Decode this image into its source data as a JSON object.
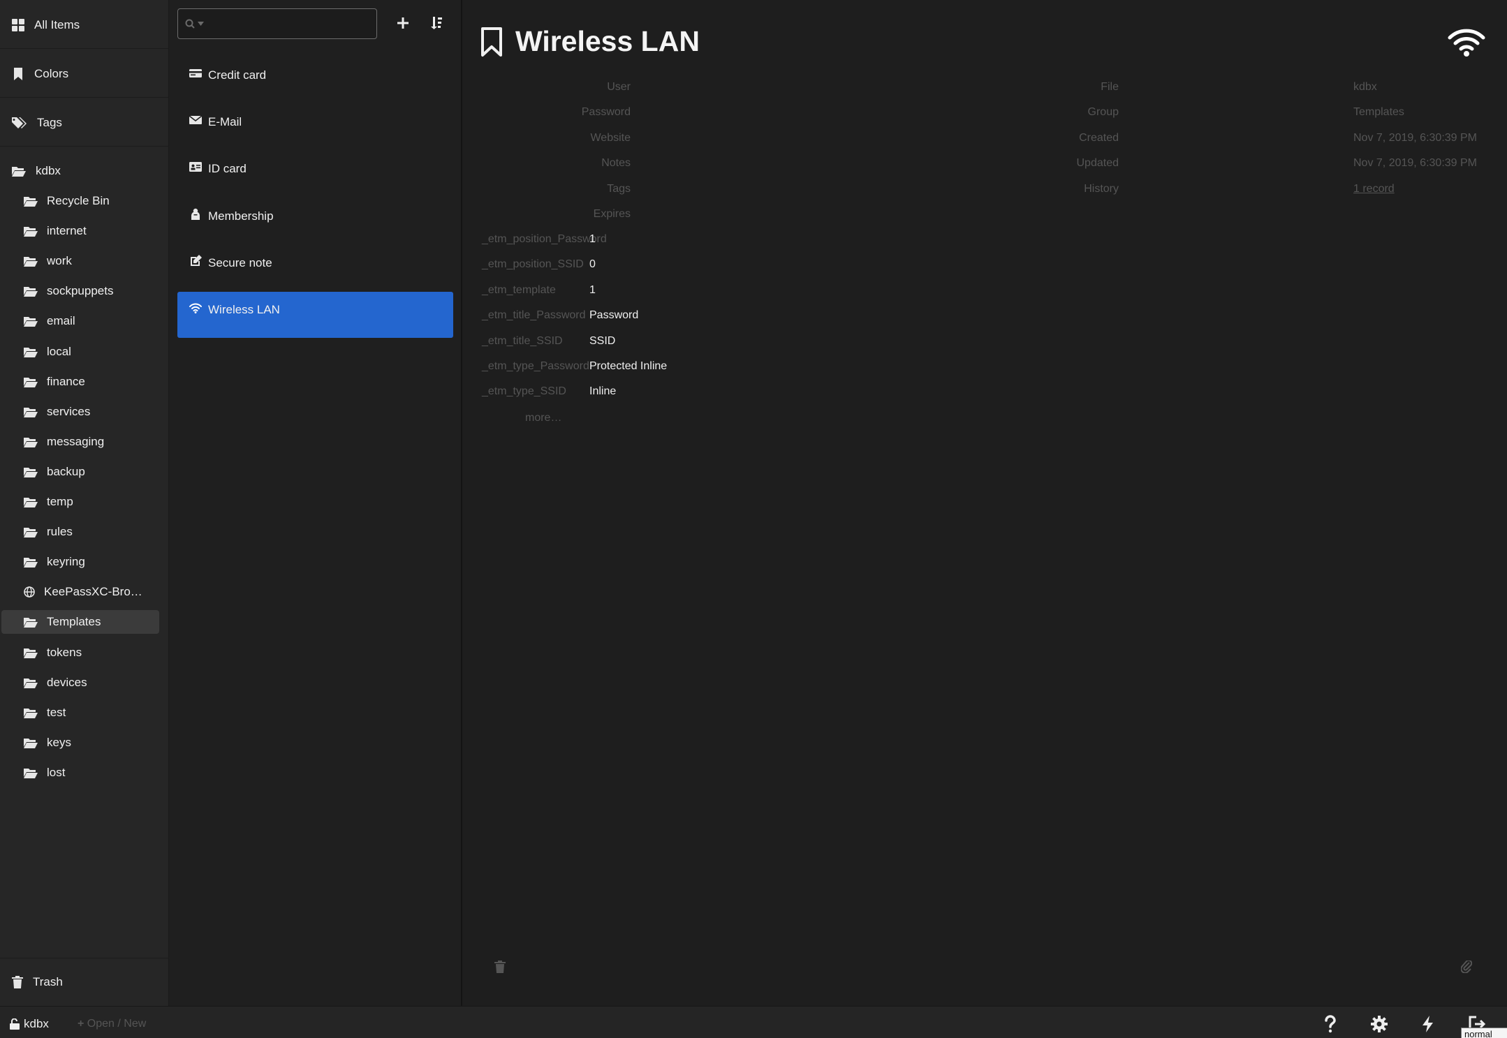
{
  "sidebar": {
    "all_items": "All Items",
    "colors": "Colors",
    "tags": "Tags",
    "db_name": "kdbx",
    "folders": [
      {
        "label": "Recycle Bin",
        "icon": "folder-open-icon"
      },
      {
        "label": "internet",
        "icon": "folder-open-icon"
      },
      {
        "label": "work",
        "icon": "folder-open-icon"
      },
      {
        "label": "sockpuppets",
        "icon": "folder-open-icon"
      },
      {
        "label": "email",
        "icon": "folder-open-icon"
      },
      {
        "label": "local",
        "icon": "folder-open-icon"
      },
      {
        "label": "finance",
        "icon": "folder-open-icon"
      },
      {
        "label": "services",
        "icon": "folder-open-icon"
      },
      {
        "label": "messaging",
        "icon": "folder-open-icon"
      },
      {
        "label": "backup",
        "icon": "folder-open-icon"
      },
      {
        "label": "temp",
        "icon": "folder-open-icon"
      },
      {
        "label": "rules",
        "icon": "folder-open-icon"
      },
      {
        "label": "keyring",
        "icon": "folder-open-icon"
      },
      {
        "label": "KeePassXC-Bro…",
        "icon": "globe-icon"
      },
      {
        "label": "Templates",
        "icon": "folder-open-icon",
        "selected": true
      },
      {
        "label": "tokens",
        "icon": "folder-open-icon"
      },
      {
        "label": "devices",
        "icon": "folder-open-icon"
      },
      {
        "label": "test",
        "icon": "folder-open-icon"
      },
      {
        "label": "keys",
        "icon": "folder-open-icon"
      },
      {
        "label": "lost",
        "icon": "folder-open-icon"
      }
    ],
    "trash": "Trash"
  },
  "list": {
    "search_value": "",
    "entries": [
      {
        "label": "Credit card",
        "icon": "credit-card-icon"
      },
      {
        "label": "E-Mail",
        "icon": "envelope-icon"
      },
      {
        "label": "ID card",
        "icon": "id-card-icon"
      },
      {
        "label": "Membership",
        "icon": "membership-icon"
      },
      {
        "label": "Secure note",
        "icon": "note-icon"
      },
      {
        "label": "Wireless LAN",
        "icon": "wifi-icon",
        "selected": true
      }
    ]
  },
  "detail": {
    "title": "Wireless LAN",
    "fields": {
      "user": "User",
      "password": "Password",
      "website": "Website",
      "notes": "Notes",
      "tags": "Tags",
      "expires": "Expires"
    },
    "custom_fields": [
      {
        "label": "_etm_position_Password",
        "value": "1"
      },
      {
        "label": "_etm_position_SSID",
        "value": "0"
      },
      {
        "label": "_etm_template",
        "value": "1"
      },
      {
        "label": "_etm_title_Password",
        "value": "Password"
      },
      {
        "label": "_etm_title_SSID",
        "value": "SSID"
      },
      {
        "label": "_etm_type_Password",
        "value": "Protected Inline"
      },
      {
        "label": "_etm_type_SSID",
        "value": "Inline"
      }
    ],
    "more": "more…",
    "meta": {
      "file_label": "File",
      "file": "kdbx",
      "group_label": "Group",
      "group": "Templates",
      "created_label": "Created",
      "created": "Nov 7, 2019, 6:30:39 PM",
      "updated_label": "Updated",
      "updated": "Nov 7, 2019, 6:30:39 PM",
      "history_label": "History",
      "history": "1 record"
    }
  },
  "footer": {
    "db_name": "kdbx",
    "open_new": "Open / New",
    "tooltip": "normal"
  },
  "colors": {
    "accent": "#2466cf",
    "selected_folder": "#3b3b3b",
    "muted_text": "#555555"
  }
}
